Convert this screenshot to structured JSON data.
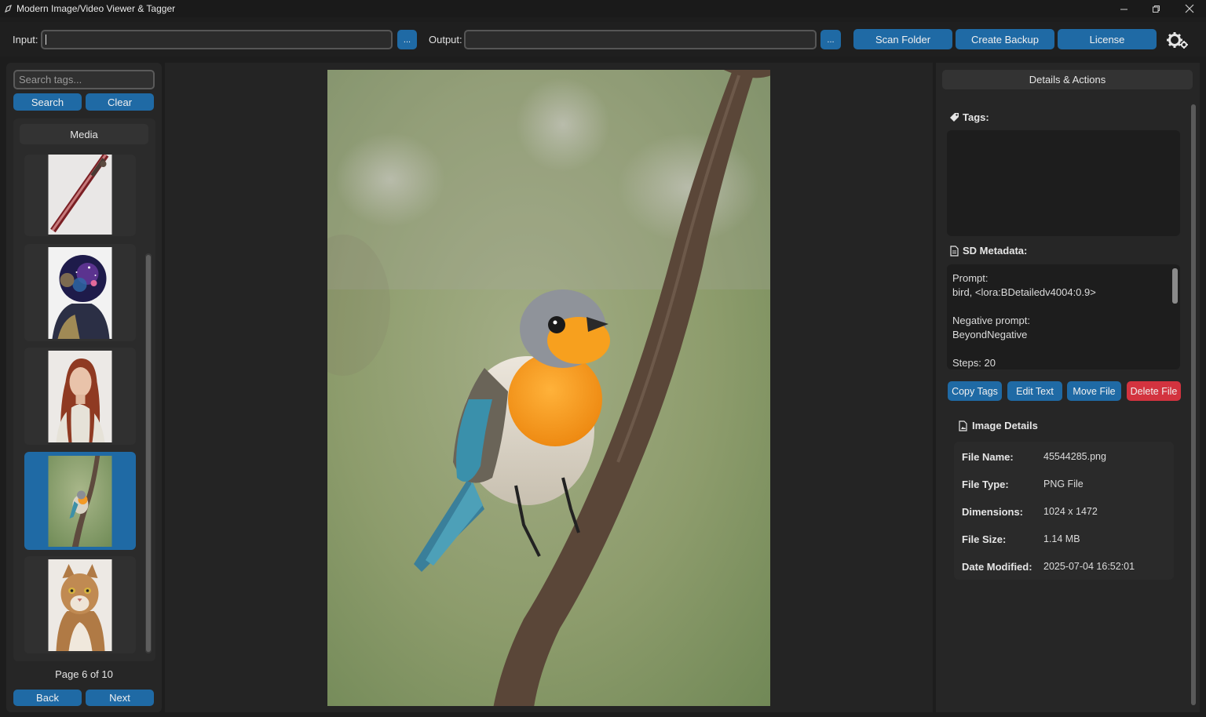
{
  "window": {
    "title": "Modern Image/Video Viewer & Tagger"
  },
  "toolbar": {
    "input_label": "Input:",
    "input_value": "",
    "input_browse": "...",
    "output_label": "Output:",
    "output_value": "",
    "output_browse": "...",
    "scan_folder": "Scan Folder",
    "create_backup": "Create Backup",
    "license": "License",
    "settings_icon": "gear-icon"
  },
  "sidebar": {
    "search_placeholder": "Search tags...",
    "search_button": "Search",
    "clear_button": "Clear",
    "media_header": "Media",
    "thumbnails": [
      {
        "subject": "sword",
        "selected": false
      },
      {
        "subject": "space-helmet-figure",
        "selected": false
      },
      {
        "subject": "red-haired-woman",
        "selected": false
      },
      {
        "subject": "robin-on-branch",
        "selected": true
      },
      {
        "subject": "cat",
        "selected": false
      }
    ],
    "page_label": "Page 6 of 10",
    "back_button": "Back",
    "next_button": "Next"
  },
  "details": {
    "header": "Details & Actions",
    "tags_title": "Tags:",
    "tags_icon": "tag-icon",
    "metadata_title": "SD Metadata:",
    "metadata_icon": "document-icon",
    "metadata_lines": {
      "prompt_label": "Prompt:",
      "prompt_value": "bird, <lora:BDetailedv4004:0.9>",
      "negative_label": "Negative prompt:",
      "negative_value": "BeyondNegative",
      "steps": "Steps: 20"
    },
    "actions": {
      "copy_tags": "Copy Tags",
      "edit_text": "Edit Text",
      "move_file": "Move File",
      "delete_file": "Delete File"
    },
    "image_details_title": "Image Details",
    "image_details_icon": "image-file-icon",
    "file": {
      "name_label": "File Name:",
      "name_value": "45544285.png",
      "type_label": "File Type:",
      "type_value": "PNG File",
      "dims_label": "Dimensions:",
      "dims_value": "1024 x 1472",
      "size_label": "File Size:",
      "size_value": "1.14 MB",
      "date_label": "Date Modified:",
      "date_value": "2025-07-04 16:52:01"
    }
  },
  "colors": {
    "accent": "#1f6aa5",
    "danger": "#d3333f",
    "background": "#1d1d1d",
    "panel": "#262626"
  }
}
